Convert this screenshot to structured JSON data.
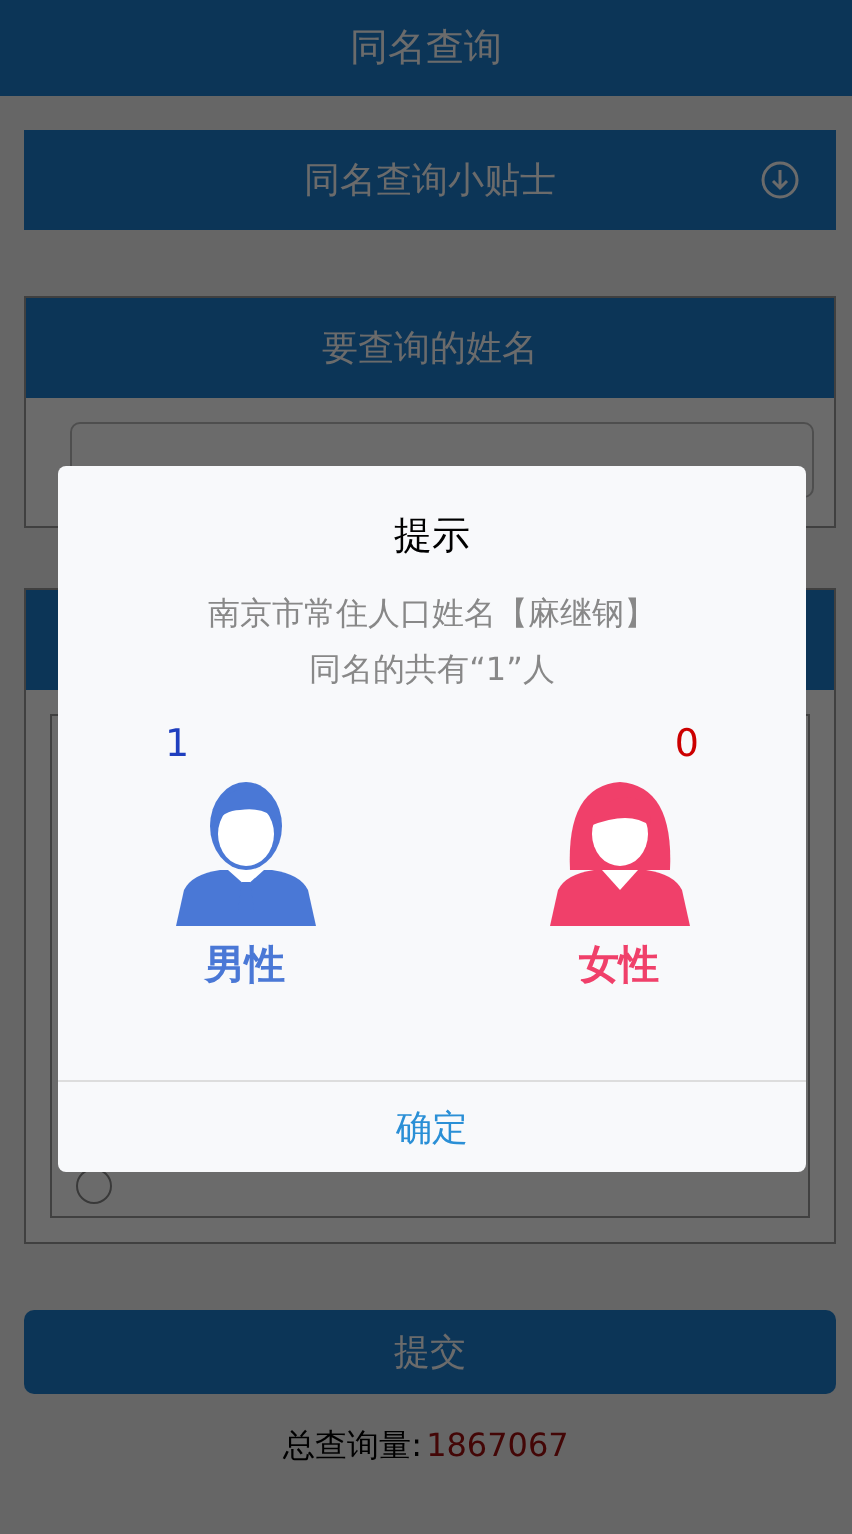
{
  "header": {
    "title": "同名查询"
  },
  "tips_bar": {
    "label": "同名查询小贴士"
  },
  "name_section": {
    "title": "要查询的姓名"
  },
  "options": [
    {
      "selected": false
    }
  ],
  "submit": {
    "label": "提交"
  },
  "total": {
    "label": "总查询量:",
    "value": "1867067"
  },
  "dialog": {
    "title": "提示",
    "message": [
      "南京市常住人口姓名【麻继钢】",
      "同名的共有“1”人"
    ],
    "counts": [
      {
        "kind": "male",
        "count": "1",
        "label": "男性"
      },
      {
        "kind": "female",
        "count": "0",
        "label": "女性"
      }
    ],
    "confirm": "确定"
  }
}
